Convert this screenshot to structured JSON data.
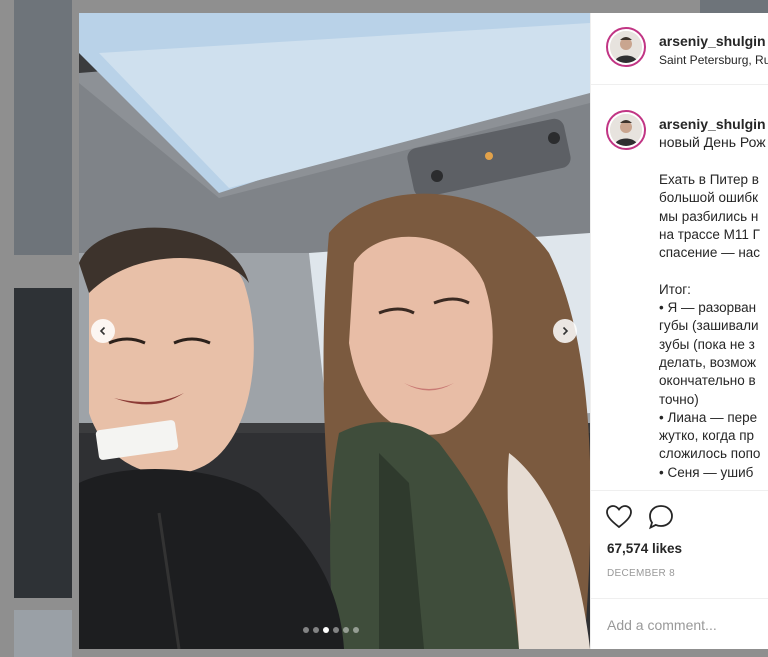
{
  "post": {
    "username": "arseniy_shulgin",
    "location": "Saint Petersburg, Ru",
    "caption_first_line": "новый День Рож",
    "caption_lines": [
      "Ехать в Питер в",
      "большой ошибк",
      "мы разбились н",
      "на трассе М11 Г",
      "спасение — нас",
      "",
      "Итог:",
      "• Я — разорван",
      "губы (зашивали",
      "зубы (пока не з",
      "делать, возмож",
      "окончательно в",
      "точно)",
      "• Лиана — пере",
      "жутко, когда пр",
      "сложилось попо",
      "• Сеня — ушиб"
    ],
    "likes": "67,574 likes",
    "date": "DECEMBER 8",
    "comment_placeholder": "Add a comment..."
  },
  "carousel": {
    "slide_count": 6,
    "active_slide": 3
  },
  "colors": {
    "story_ring": "#c13584",
    "text": "#262626",
    "muted": "#999999",
    "divider": "#efefef"
  },
  "icons": {
    "prev": "chevron-left-icon",
    "next": "chevron-right-icon",
    "like": "heart-icon",
    "comment": "comment-bubble-icon"
  }
}
